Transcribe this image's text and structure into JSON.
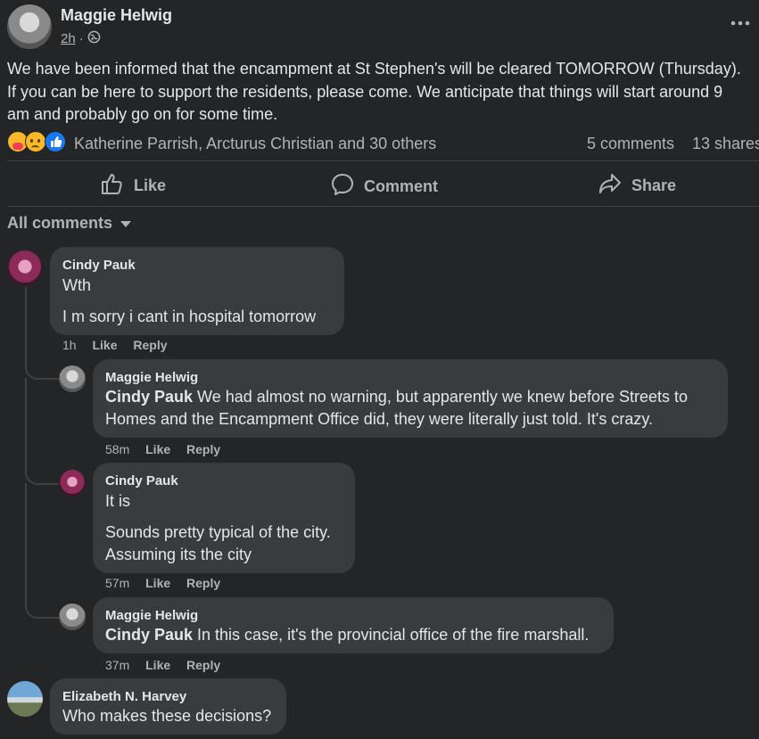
{
  "post": {
    "author": "Maggie Helwig",
    "time": "2h",
    "separator": "·",
    "body_lines": [
      "We have been informed that the encampment at St Stephen's will be cleared TOMORROW (Thursday).",
      "If you can be here to support the residents, please come. We anticipate that things will start around 9",
      "am and probably go on for some time."
    ],
    "reactions_text": "Katherine Parrish, Arcturus Christian and 30 others",
    "comments_count": "5 comments",
    "shares_count": "13 shares",
    "reaction_icons": [
      "care-reaction-icon",
      "sad-reaction-icon",
      "like-reaction-icon"
    ]
  },
  "actions": {
    "like": "Like",
    "comment": "Comment",
    "share": "Share"
  },
  "filter": {
    "label": "All comments"
  },
  "comments": [
    {
      "name": "Cindy Pauk",
      "lines": [
        "Wth",
        "I m sorry i cant in hospital tomorrow"
      ],
      "time": "1h",
      "like": "Like",
      "reply": "Reply"
    },
    {
      "name": "Maggie Helwig",
      "mention": "Cindy Pauk",
      "lines": [
        " We had almost no warning, but apparently we knew before Streets to",
        "Homes and the Encampment Office did, they were literally just told. It's crazy."
      ],
      "time": "58m",
      "like": "Like",
      "reply": "Reply"
    },
    {
      "name": "Cindy Pauk",
      "lines": [
        "It is",
        "Sounds pretty typical of the city.",
        "Assuming its the city"
      ],
      "time": "57m",
      "like": "Like",
      "reply": "Reply"
    },
    {
      "name": "Maggie Helwig",
      "mention": "Cindy Pauk",
      "lines": [
        " In this case, it's the provincial office of the fire marshall."
      ],
      "time": "37m",
      "like": "Like",
      "reply": "Reply"
    },
    {
      "name": "Elizabeth N. Harvey",
      "lines": [
        "Who makes these decisions?"
      ]
    }
  ],
  "colors": {
    "background": "#242526",
    "bubble": "#3a3b3c",
    "text": "#e4e6eb",
    "muted": "#b0b3b8",
    "like_blue": "#1877f2",
    "reaction_yellow": "#f7b928"
  }
}
